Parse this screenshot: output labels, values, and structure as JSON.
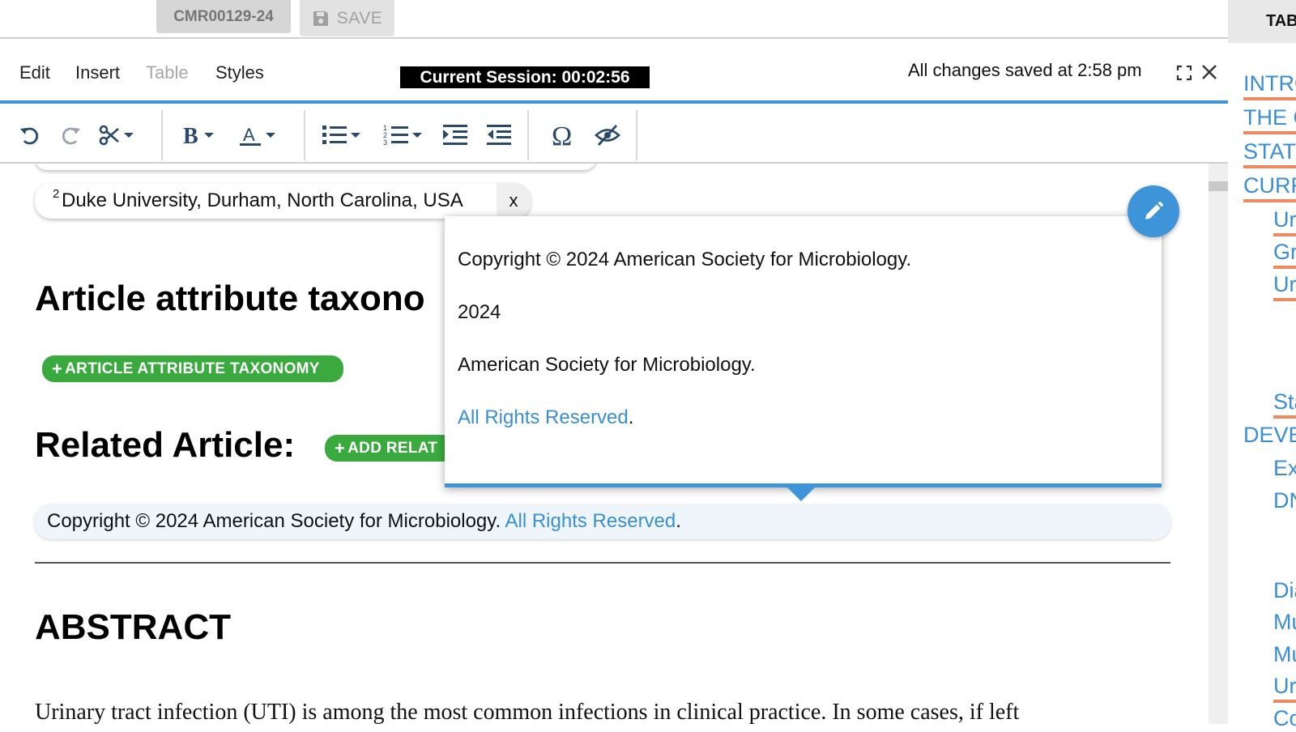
{
  "topbar": {
    "doc_id": "CMR00129-24",
    "save_label": "SAVE"
  },
  "menubar": {
    "items": [
      {
        "label": "Edit",
        "enabled": true
      },
      {
        "label": "Insert",
        "enabled": true
      },
      {
        "label": "Table",
        "enabled": false
      },
      {
        "label": "Styles",
        "enabled": true
      }
    ],
    "session": "Current Session: 00:02:56",
    "saved_status": "All changes saved at 2:58 pm"
  },
  "toolbar": {
    "buttons": [
      "undo-icon",
      "redo-icon",
      "cut-icon",
      "bold-icon",
      "font-color-icon",
      "bullet-list-icon",
      "numbered-list-icon",
      "indent-icon",
      "outdent-icon",
      "special-char-icon",
      "hide-icon"
    ]
  },
  "content": {
    "affiliation_sup": "2",
    "affiliation": "Duke University, Durham, North Carolina, USA",
    "affiliation_remove": "x",
    "taxonomy_heading": "Article attribute taxono",
    "taxonomy_button": "ARTICLE ATTRIBUTE TAXONOMY",
    "related_heading": "Related Article:",
    "related_button": "ADD RELAT",
    "copyright_text": "Copyright © 2024 American Society for Microbiology.",
    "copyright_link": "All Rights Reserved",
    "copyright_period": ".",
    "abstract_heading": "ABSTRACT",
    "abstract_text": "Urinary tract infection (UTI) is among the most common infections in clinical practice. In some cases, if left"
  },
  "popup": {
    "line1": "Copyright © 2024 American Society for Microbiology.",
    "line2": "2024",
    "line3": "American Society for Microbiology.",
    "link": "All Rights Reserved",
    "period": "."
  },
  "toc": {
    "header": "TABLE",
    "items": [
      {
        "label": "INTRO",
        "underline": true
      },
      {
        "label": "THE C",
        "underline": true
      },
      {
        "label": "STATU",
        "underline": true
      },
      {
        "label": "CURR",
        "underline": true
      },
      {
        "label": "Ur",
        "underline": true
      },
      {
        "label": "Gr",
        "underline": true
      },
      {
        "label": "Ur",
        "underline": true
      },
      {
        "label": "Sta",
        "underline": true
      },
      {
        "label": "DEVE",
        "underline": false
      },
      {
        "label": "Ex",
        "underline": false
      },
      {
        "label": "DN",
        "underline": false
      },
      {
        "label": "Dia",
        "underline": false
      },
      {
        "label": "Mu",
        "underline": false
      },
      {
        "label": "Mu",
        "underline": false
      },
      {
        "label": "Ur",
        "underline": true
      },
      {
        "label": "Co",
        "underline": false
      }
    ]
  },
  "colors": {
    "accent_blue": "#3e94d8",
    "link_blue": "#3a8fd3",
    "tag_green": "#3aaa3f",
    "toc_underline": "#ee8a5e"
  }
}
